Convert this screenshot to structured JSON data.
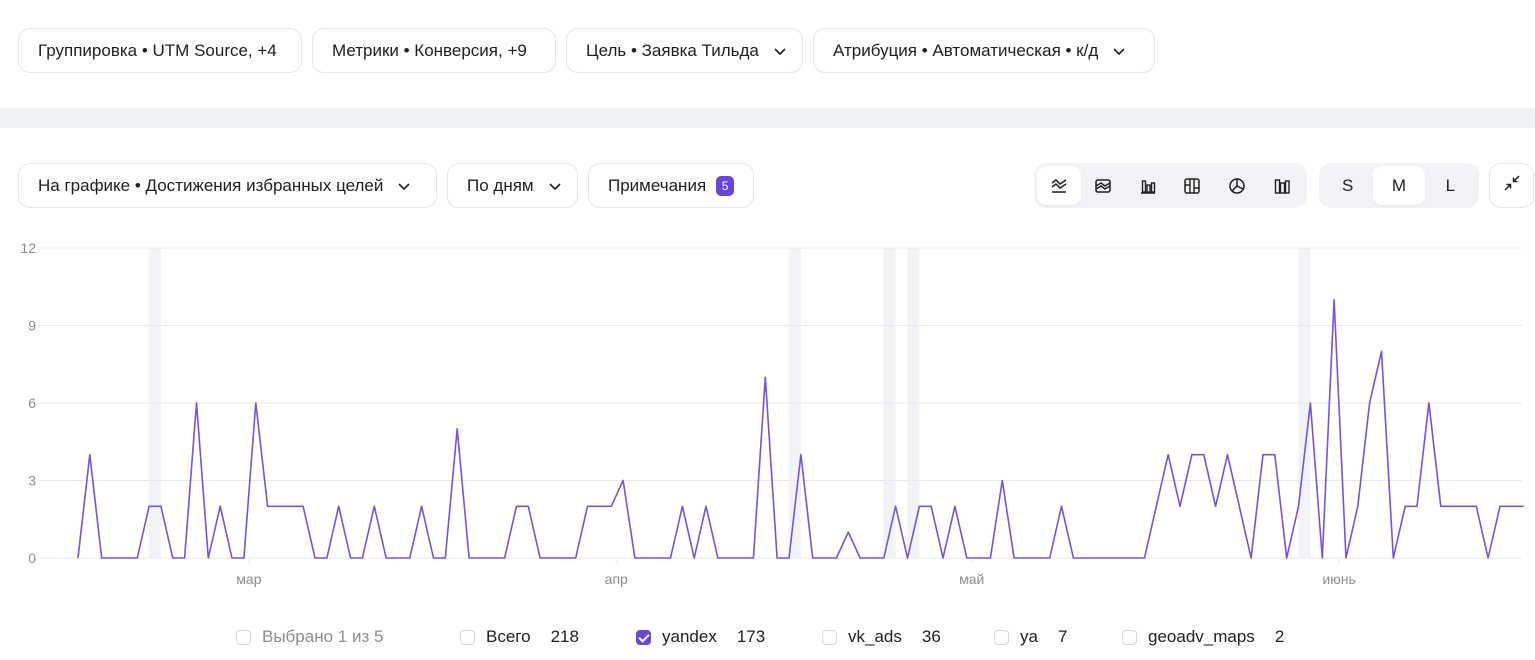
{
  "filters": {
    "grouping": "Группировка • UTM Source, +4",
    "metrics": "Метрики • Конверсия, +9",
    "goal": "Цель • Заявка Тильда",
    "attribution": "Атрибуция • Автоматическая • к/д"
  },
  "toolbar": {
    "on_chart": "На графике • Достижения избранных целей",
    "period": "По дням",
    "notes_label": "Примечания",
    "notes_count": "5",
    "chart_types": [
      "line-chart-icon",
      "area-chart-icon",
      "bar-chart-icon",
      "stacked-chart-icon",
      "pie-chart-icon",
      "column-chart-icon"
    ],
    "sizes": [
      "S",
      "M",
      "L"
    ],
    "active_size": "M"
  },
  "legend": {
    "selected": "Выбрано 1 из 5",
    "items": [
      {
        "label": "Всего",
        "value": "218",
        "checked": false
      },
      {
        "label": "yandex",
        "value": "173",
        "checked": true
      },
      {
        "label": "vk_ads",
        "value": "36",
        "checked": false
      },
      {
        "label": "ya",
        "value": "7",
        "checked": false
      },
      {
        "label": "geoadv_maps",
        "value": "2",
        "checked": false
      }
    ]
  },
  "colors": {
    "series": "#7b4fe0",
    "accent": "#6a45d9",
    "grid": "#e7e9ee",
    "weekend": "#f1f3f6",
    "tick": "#8a8d94"
  },
  "chart_data": {
    "type": "line",
    "x_unit": "day",
    "x_start_label": "мар",
    "ylim": [
      0,
      12
    ],
    "yticks": [
      0,
      3,
      6,
      9,
      12
    ],
    "xticks": [
      {
        "label": "мар",
        "index": 14
      },
      {
        "label": "апр",
        "index": 45
      },
      {
        "label": "май",
        "index": 75
      },
      {
        "label": "июнь",
        "index": 106
      }
    ],
    "highlight_days": [
      7,
      61,
      69,
      71,
      104
    ],
    "series": [
      {
        "label": "yandex",
        "values": [
          0,
          4,
          0,
          0,
          0,
          0,
          2,
          2,
          0,
          0,
          6,
          0,
          2,
          0,
          0,
          6,
          2,
          2,
          2,
          2,
          0,
          0,
          2,
          0,
          0,
          2,
          0,
          0,
          0,
          2,
          0,
          0,
          5,
          0,
          0,
          0,
          0,
          2,
          2,
          0,
          0,
          0,
          0,
          2,
          2,
          2,
          3,
          0,
          0,
          0,
          0,
          2,
          0,
          2,
          0,
          0,
          0,
          0,
          7,
          0,
          0,
          4,
          0,
          0,
          0,
          1,
          0,
          0,
          0,
          2,
          0,
          2,
          2,
          0,
          2,
          0,
          0,
          0,
          3,
          0,
          0,
          0,
          0,
          2,
          0,
          0,
          0,
          0,
          0,
          0,
          0,
          2,
          4,
          2,
          4,
          4,
          2,
          4,
          2,
          0,
          4,
          4,
          0,
          2,
          6,
          0,
          10,
          0,
          2,
          6,
          8,
          0,
          2,
          2,
          6,
          2,
          2,
          2,
          2,
          0,
          2,
          2,
          2
        ]
      }
    ]
  }
}
